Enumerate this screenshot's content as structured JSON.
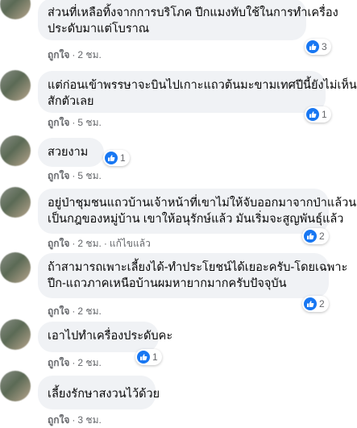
{
  "comments": [
    {
      "lines": [
        "ส่วนที่เหลือทิ้งจากการบริโภค ปีกแมงทับใช้ในการทำเครื่อง",
        "ประดับมาแต่โบราณ"
      ],
      "reactions": "3",
      "like": "ถูกใจ",
      "time": "2 ชม.",
      "edited": ""
    },
    {
      "lines": [
        "แต่ก่อนเข้าพรรษาจะบินไปเกาะแถวต้นมะขามเทศปีนี้ยังไม่เห็น",
        "สักตัวเลย"
      ],
      "reactions": "1",
      "like": "ถูกใจ",
      "time": "5 ชม.",
      "edited": ""
    },
    {
      "lines": [
        "สวยงาม"
      ],
      "reactions": "1",
      "like": "ถูกใจ",
      "time": "5 ชม.",
      "edited": ""
    },
    {
      "lines": [
        "อยู่ป่าชุมชนแถวบ้านเจ้าหน้าที่เขาไม่ให้จับออกมาจากป่าแล้วนะ",
        "เป็นกฎของหมู่บ้าน เขาให้อนุรักษ์แล้ว มันเริ่มจะสูญพันธุ์แล้ว"
      ],
      "reactions": "2",
      "like": "ถูกใจ",
      "time": "2 ชม.",
      "edited": "แก้ไขแล้ว"
    },
    {
      "lines": [
        "ถ้าสามารถเพาะเลี้ยงได้-ทำประโยชน์ได้เยอะครับ-โดยเฉพาะ",
        "ปีก-แถวภาคเหนือบ้านผมหายากมากครับปัจจุบัน"
      ],
      "reactions": "2",
      "like": "ถูกใจ",
      "time": "2 ชม.",
      "edited": ""
    },
    {
      "lines": [
        "เอาไปทำเครื่องประดับคะ"
      ],
      "reactions": "1",
      "like": "ถูกใจ",
      "time": "2 ชม.",
      "edited": ""
    },
    {
      "lines": [
        "เลี้ยงรักษาสงวนไว้ด้วย"
      ],
      "reactions": "",
      "like": "ถูกใจ",
      "time": "3 ชม.",
      "edited": ""
    }
  ]
}
